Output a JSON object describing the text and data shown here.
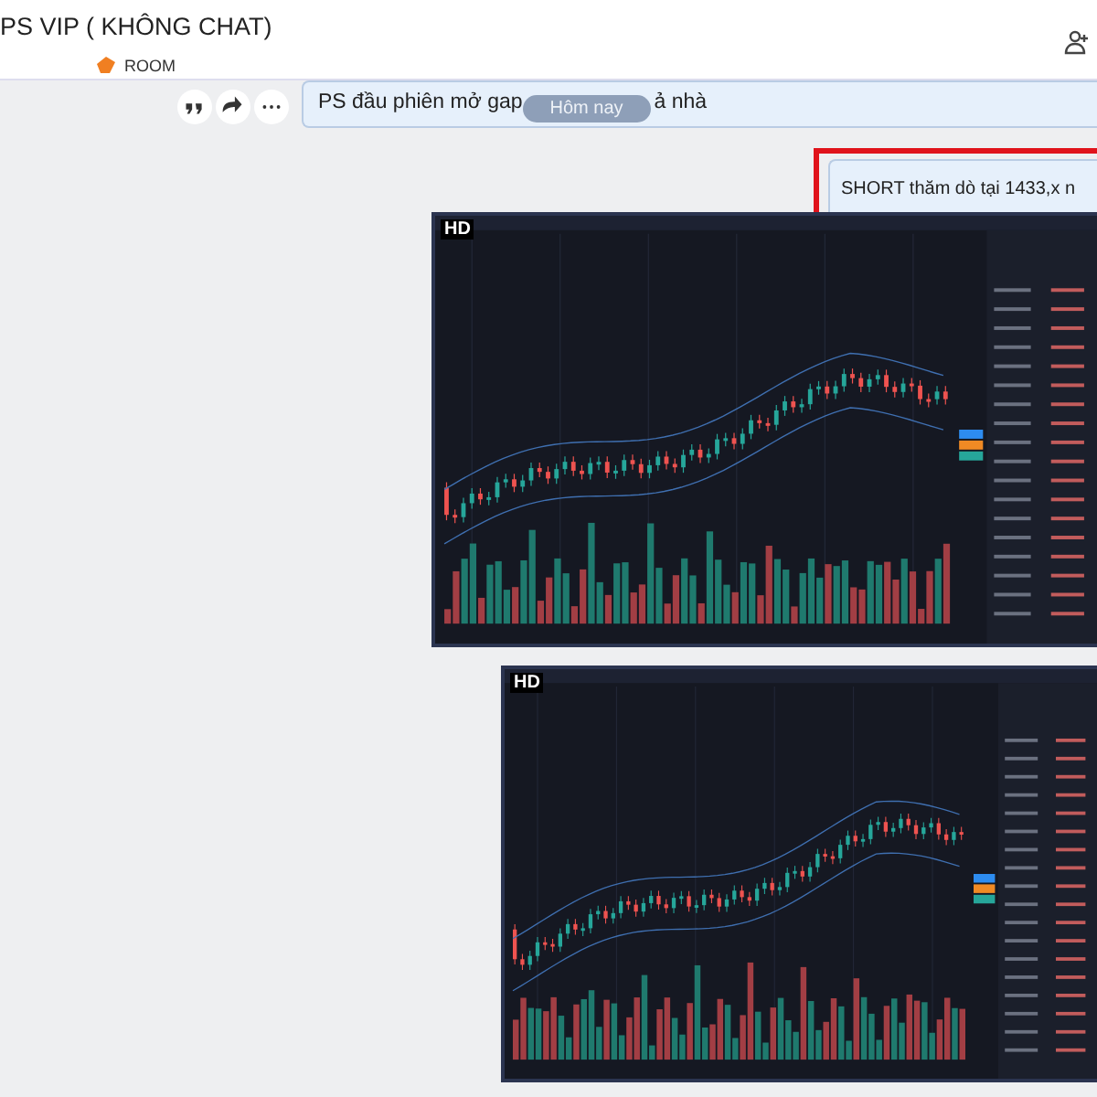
{
  "header": {
    "title": "PS VIP ( KHÔNG CHAT)",
    "room_label": "ROOM"
  },
  "date_divider": "Hôm nay",
  "messages": [
    {
      "kind": "text",
      "parts": [
        "PS đầu phiên mở gap",
        "ả nhà"
      ],
      "highlighted": false,
      "actions": true
    },
    {
      "kind": "text",
      "parts": [
        "SHORT thăm dò tại 1433,x n"
      ],
      "highlighted": true,
      "actions": false
    },
    {
      "kind": "image",
      "badge": "HD"
    },
    {
      "kind": "image",
      "badge": "HD"
    }
  ]
}
